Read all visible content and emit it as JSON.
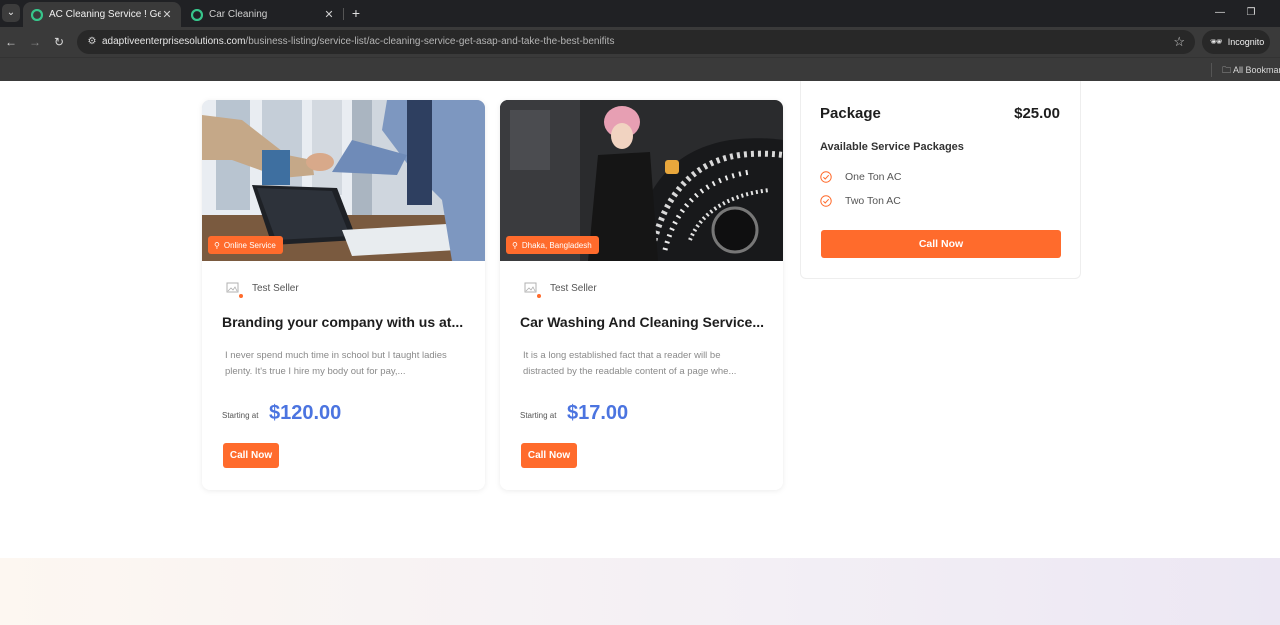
{
  "browser": {
    "tabs": [
      {
        "title": "AC Cleaning Service ! Get ASAP",
        "active": true
      },
      {
        "title": "Car Cleaning",
        "active": false
      }
    ],
    "new_tab": "+",
    "url_domain": "adaptiveenterprisesolutions.com",
    "url_path": "/business-listing/service-list/ac-cleaning-service-get-asap-and-take-the-best-benifits",
    "incognito_label": "Incognito",
    "bookmarks_label": "All Bookmarks"
  },
  "cards": [
    {
      "location": "Online Service",
      "seller": "Test Seller",
      "title": "Branding your company with us at...",
      "description": "I never spend much time in school but I taught ladies plenty. It's true I hire my body out for pay,...",
      "starting_label": "Starting at",
      "price": "$120.00",
      "button": "Call Now"
    },
    {
      "location": "Dhaka, Bangladesh",
      "seller": "Test Seller",
      "title": "Car Washing And Cleaning Service...",
      "description": "It is a long established fact that a reader will be distracted by the readable content of a page whe...",
      "starting_label": "Starting at",
      "price": "$17.00",
      "button": "Call Now"
    }
  ],
  "package": {
    "title": "Package",
    "price": "$25.00",
    "subtitle": "Available Service Packages",
    "items": [
      "One Ton AC",
      "Two Ton AC"
    ],
    "button": "Call Now"
  },
  "colors": {
    "accent": "#ff6b2c",
    "price": "#4b74e0",
    "chrome": "#202124"
  }
}
